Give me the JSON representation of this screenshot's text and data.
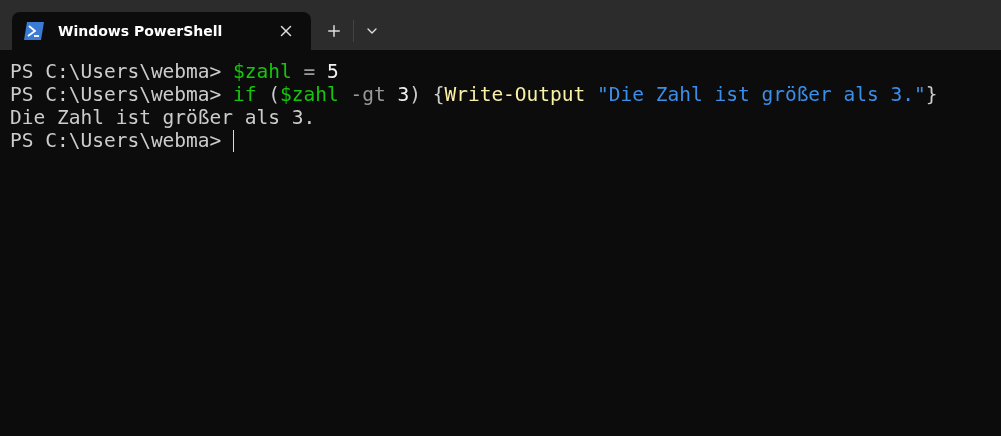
{
  "tabs": [
    {
      "title": "Windows PowerShell",
      "selected": true
    }
  ],
  "terminal": {
    "lines": [
      {
        "segments": [
          {
            "kind": "prompt",
            "text": "PS C:\\Users\\webma> "
          },
          {
            "kind": "variable",
            "text": "$zahl"
          },
          {
            "kind": "operator",
            "text": " = "
          },
          {
            "kind": "number",
            "text": "5"
          }
        ]
      },
      {
        "segments": [
          {
            "kind": "prompt",
            "text": "PS C:\\Users\\webma> "
          },
          {
            "kind": "keyword",
            "text": "if"
          },
          {
            "kind": "plain",
            "text": " ("
          },
          {
            "kind": "variable",
            "text": "$zahl"
          },
          {
            "kind": "operator",
            "text": " -gt "
          },
          {
            "kind": "number",
            "text": "3"
          },
          {
            "kind": "plain",
            "text": ") {"
          },
          {
            "kind": "command",
            "text": "Write-Output "
          },
          {
            "kind": "string",
            "text": "\"Die Zahl ist größer als 3.\""
          },
          {
            "kind": "plain",
            "text": "}"
          }
        ]
      },
      {
        "segments": [
          {
            "kind": "output",
            "text": "Die Zahl ist größer als 3."
          }
        ]
      },
      {
        "segments": [
          {
            "kind": "prompt",
            "text": "PS C:\\Users\\webma> "
          }
        ],
        "cursor": true
      }
    ]
  }
}
